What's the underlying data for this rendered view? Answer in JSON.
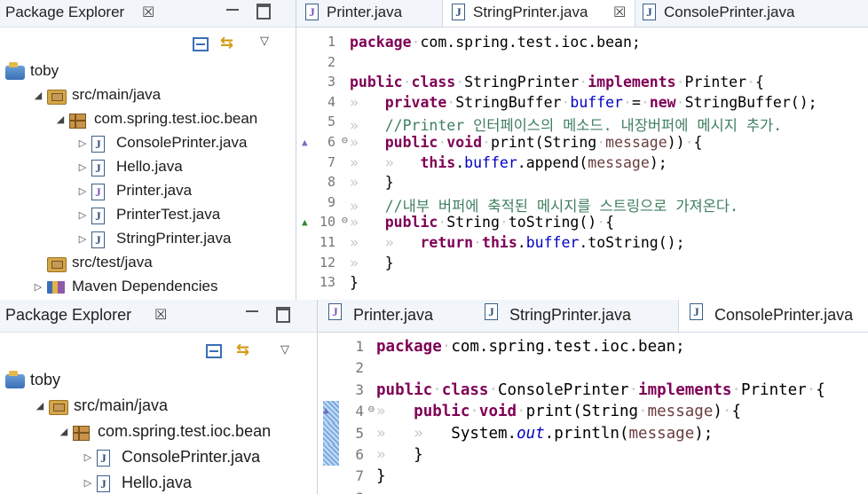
{
  "top": {
    "package_explorer": {
      "title": "Package Explorer",
      "close_glyph": "☒",
      "tree": [
        {
          "depth": 0,
          "twisty": "",
          "icon": "project",
          "label": "toby"
        },
        {
          "depth": 1,
          "twisty": "◢",
          "icon": "source-folder",
          "label": "src/main/java"
        },
        {
          "depth": 2,
          "twisty": "◢",
          "icon": "package",
          "label": "com.spring.test.ioc.bean"
        },
        {
          "depth": 3,
          "twisty": "▷",
          "icon": "java-file",
          "label": "ConsolePrinter.java"
        },
        {
          "depth": 3,
          "twisty": "▷",
          "icon": "java-file",
          "label": "Hello.java"
        },
        {
          "depth": 3,
          "twisty": "▷",
          "icon": "java-interface",
          "label": "Printer.java"
        },
        {
          "depth": 3,
          "twisty": "▷",
          "icon": "java-file",
          "label": "PrinterTest.java"
        },
        {
          "depth": 3,
          "twisty": "▷",
          "icon": "java-file",
          "label": "StringPrinter.java"
        },
        {
          "depth": 1,
          "twisty": "",
          "icon": "source-folder",
          "label": "src/test/java"
        },
        {
          "depth": 1,
          "twisty": "▷",
          "icon": "library",
          "label": "Maven Dependencies"
        }
      ]
    },
    "editor": {
      "tabs": [
        {
          "label": "Printer.java",
          "active": false
        },
        {
          "label": "StringPrinter.java",
          "active": true,
          "close": "☒"
        },
        {
          "label": "ConsolePrinter.java",
          "active": false
        }
      ],
      "lines": [
        {
          "n": "1",
          "tokens": [
            [
              "kw",
              "package"
            ],
            [
              "ws",
              "·"
            ],
            [
              "",
              "com.spring.test.ioc.bean;"
            ]
          ]
        },
        {
          "n": "2",
          "tokens": []
        },
        {
          "n": "3",
          "tokens": [
            [
              "kw",
              "public"
            ],
            [
              "ws",
              "·"
            ],
            [
              "kw",
              "class"
            ],
            [
              "ws",
              "·"
            ],
            [
              "",
              "StringPrinter"
            ],
            [
              "ws",
              "·"
            ],
            [
              "kw",
              "implements"
            ],
            [
              "ws",
              "·"
            ],
            [
              "",
              "Printer"
            ],
            [
              "ws",
              "·"
            ],
            [
              "",
              "{"
            ]
          ]
        },
        {
          "n": "4",
          "tokens": [
            [
              "ws",
              "»   "
            ],
            [
              "kw",
              "private"
            ],
            [
              "ws",
              "·"
            ],
            [
              "",
              "StringBuffer"
            ],
            [
              "ws",
              "·"
            ],
            [
              "fld",
              "buffer"
            ],
            [
              "ws",
              "·"
            ],
            [
              "",
              "="
            ],
            [
              "ws",
              "·"
            ],
            [
              "kw",
              "new"
            ],
            [
              "ws",
              "·"
            ],
            [
              "",
              "StringBuffer();"
            ]
          ]
        },
        {
          "n": "5",
          "tokens": [
            [
              "ws",
              "»   "
            ],
            [
              "cmt",
              "//Printer 인터페이스의 메소드. 내장버퍼에 메시지 추가."
            ]
          ]
        },
        {
          "n": "6",
          "fold": "⊖",
          "marker": "impl",
          "tokens": [
            [
              "ws",
              "»   "
            ],
            [
              "kw",
              "public"
            ],
            [
              "ws",
              "·"
            ],
            [
              "kw",
              "void"
            ],
            [
              "ws",
              "·"
            ],
            [
              "",
              "print(String"
            ],
            [
              "ws",
              "·"
            ],
            [
              "param",
              "message"
            ],
            [
              "",
              "))"
            ],
            [
              "ws",
              "·"
            ],
            [
              "",
              "{"
            ]
          ]
        },
        {
          "n": "7",
          "tokens": [
            [
              "ws",
              "»   »   "
            ],
            [
              "kw",
              "this"
            ],
            [
              "",
              "."
            ],
            [
              "fld",
              "buffer"
            ],
            [
              "",
              ".append("
            ],
            [
              "param",
              "message"
            ],
            [
              "",
              ");"
            ]
          ]
        },
        {
          "n": "8",
          "tokens": [
            [
              "ws",
              "»   "
            ],
            [
              "",
              "}"
            ]
          ]
        },
        {
          "n": "9",
          "tokens": [
            [
              "ws",
              "»   "
            ],
            [
              "cmt",
              "//내부 버퍼에 축적된 메시지를 스트링으로 가져온다."
            ]
          ]
        },
        {
          "n": "10",
          "fold": "⊖",
          "marker": "override",
          "tokens": [
            [
              "ws",
              "»   "
            ],
            [
              "kw",
              "public"
            ],
            [
              "ws",
              "·"
            ],
            [
              "",
              "String"
            ],
            [
              "ws",
              "·"
            ],
            [
              "",
              "toString()"
            ],
            [
              "ws",
              "·"
            ],
            [
              "",
              "{"
            ]
          ]
        },
        {
          "n": "11",
          "tokens": [
            [
              "ws",
              "»   »   "
            ],
            [
              "kw",
              "return"
            ],
            [
              "ws",
              "·"
            ],
            [
              "kw",
              "this"
            ],
            [
              "",
              "."
            ],
            [
              "fld",
              "buffer"
            ],
            [
              "",
              ".toString();"
            ]
          ]
        },
        {
          "n": "12",
          "tokens": [
            [
              "ws",
              "»   "
            ],
            [
              "",
              "}"
            ]
          ]
        },
        {
          "n": "13",
          "tokens": [
            [
              "",
              "}"
            ]
          ]
        }
      ]
    }
  },
  "bottom": {
    "package_explorer": {
      "title": "Package Explorer",
      "close_glyph": "☒",
      "tree": [
        {
          "depth": 0,
          "twisty": "",
          "icon": "project",
          "label": "toby"
        },
        {
          "depth": 1,
          "twisty": "◢",
          "icon": "source-folder",
          "label": "src/main/java"
        },
        {
          "depth": 2,
          "twisty": "◢",
          "icon": "package",
          "label": "com.spring.test.ioc.bean"
        },
        {
          "depth": 3,
          "twisty": "▷",
          "icon": "java-file",
          "label": "ConsolePrinter.java"
        },
        {
          "depth": 3,
          "twisty": "▷",
          "icon": "java-file",
          "label": "Hello.java"
        }
      ]
    },
    "editor": {
      "tabs": [
        {
          "label": "Printer.java",
          "active": false
        },
        {
          "label": "StringPrinter.java",
          "active": false
        },
        {
          "label": "ConsolePrinter.java",
          "active": true
        }
      ],
      "lines": [
        {
          "n": "1",
          "tokens": [
            [
              "kw",
              "package"
            ],
            [
              "ws",
              "·"
            ],
            [
              "",
              "com.spring.test.ioc.bean;"
            ]
          ]
        },
        {
          "n": "2",
          "tokens": []
        },
        {
          "n": "3",
          "tokens": [
            [
              "kw",
              "public"
            ],
            [
              "ws",
              "·"
            ],
            [
              "kw",
              "class"
            ],
            [
              "ws",
              "·"
            ],
            [
              "",
              "ConsolePrinter"
            ],
            [
              "ws",
              "·"
            ],
            [
              "kw",
              "implements"
            ],
            [
              "ws",
              "·"
            ],
            [
              "",
              "Printer"
            ],
            [
              "ws",
              "·"
            ],
            [
              "",
              "{"
            ]
          ]
        },
        {
          "n": "4",
          "fold": "⊖",
          "marker": "impl",
          "selected": true,
          "tokens": [
            [
              "ws",
              "»   "
            ],
            [
              "kw",
              "public"
            ],
            [
              "ws",
              "·"
            ],
            [
              "kw",
              "void"
            ],
            [
              "ws",
              "·"
            ],
            [
              "",
              "print(String"
            ],
            [
              "ws",
              "·"
            ],
            [
              "param",
              "message"
            ],
            [
              "",
              ")"
            ],
            [
              "ws",
              "·"
            ],
            [
              "",
              "{"
            ]
          ]
        },
        {
          "n": "5",
          "selected": true,
          "tokens": [
            [
              "ws",
              "»   »   "
            ],
            [
              "",
              "System."
            ],
            [
              "sfld",
              "out"
            ],
            [
              "",
              ".println("
            ],
            [
              "param",
              "message"
            ],
            [
              "",
              ");"
            ]
          ]
        },
        {
          "n": "6",
          "selected": true,
          "tokens": [
            [
              "ws",
              "»   "
            ],
            [
              "",
              "}"
            ]
          ]
        },
        {
          "n": "7",
          "tokens": [
            [
              "",
              "}"
            ]
          ]
        },
        {
          "n": "8",
          "caret": true,
          "tokens": []
        }
      ]
    }
  }
}
